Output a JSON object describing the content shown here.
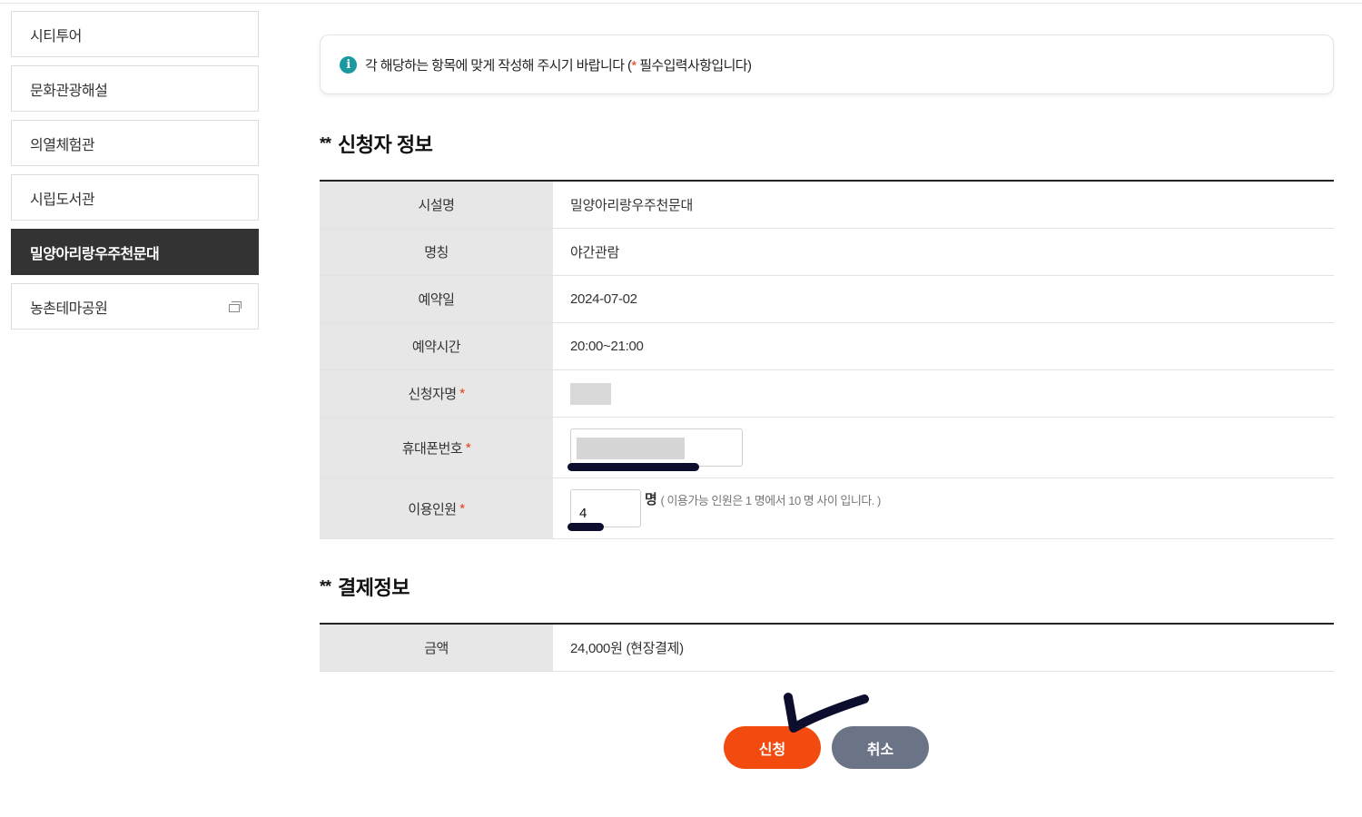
{
  "colors": {
    "active_bg": "#333333",
    "required": "#e8380d",
    "info": "#1a9aa0",
    "apply_button": "#f24a0f",
    "cancel_button": "#6b7386",
    "annotation_ink": "#0d0d2e"
  },
  "sidebar": {
    "items": [
      {
        "label": "시티투어",
        "active": false
      },
      {
        "label": "문화관광해설",
        "active": false
      },
      {
        "label": "의열체험관",
        "active": false
      },
      {
        "label": "시립도서관",
        "active": false
      },
      {
        "label": "밀양아리랑우주천문대",
        "active": true
      },
      {
        "label": "농촌테마공원",
        "active": false,
        "icon": "new-window-icon"
      }
    ]
  },
  "notice": {
    "icon": "info-icon",
    "text_before": "각 해당하는 항목에 맞게 작성해 주시기 바랍니다 (",
    "star": "*",
    "text_after": " 필수입력사항입니다)"
  },
  "applicant_section": {
    "stars": "**",
    "title": "신청자 정보",
    "rows": {
      "facility": {
        "label": "시설명",
        "value": "밀양아리랑우주천문대"
      },
      "program": {
        "label": "명칭",
        "value": "야간관람"
      },
      "date": {
        "label": "예약일",
        "value": "2024-07-02"
      },
      "time": {
        "label": "예약시간",
        "value": "20:00~21:00"
      },
      "name": {
        "label": "신청자명",
        "required": "*"
      },
      "phone": {
        "label": "휴대폰번호",
        "required": "*"
      },
      "count": {
        "label": "이용인원",
        "required": "*",
        "value": "4",
        "unit": "명",
        "help": "( 이용가능 인원은 1 명에서 10 명 사이 입니다. )"
      }
    }
  },
  "payment_section": {
    "stars": "**",
    "title": "결제정보",
    "amount": {
      "label": "금액",
      "value": "24,000원 (현장결제)"
    }
  },
  "buttons": {
    "apply": "신청",
    "cancel": "취소"
  }
}
